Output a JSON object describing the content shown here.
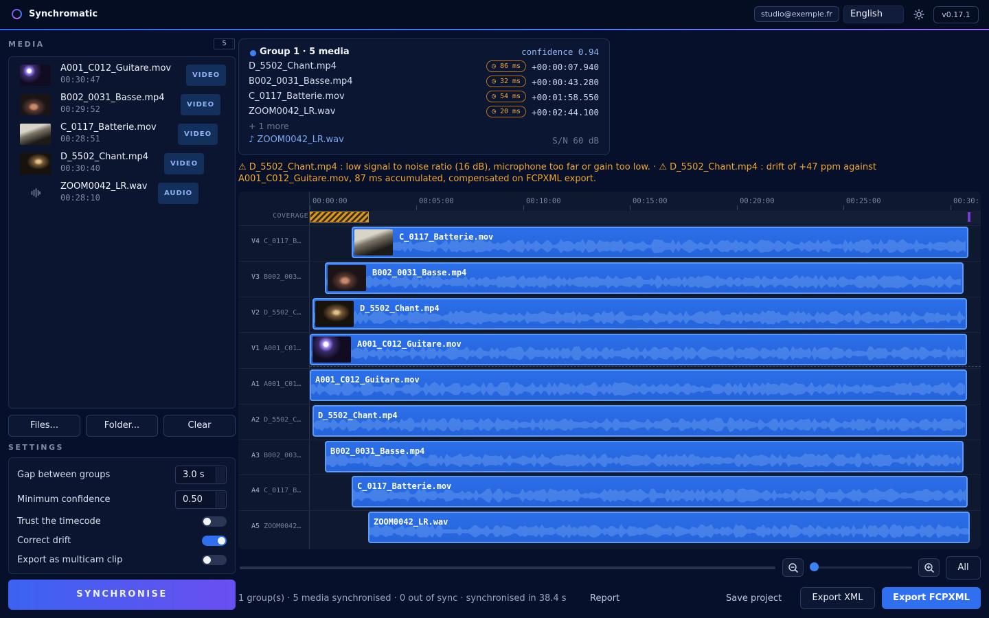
{
  "app": {
    "title": "Synchromatic",
    "account": "studio@exemple.fr",
    "language": "English",
    "version": "v0.17.1"
  },
  "media": {
    "section_title": "MEDIA",
    "count": "5",
    "items": [
      {
        "name": "A001_C012_Guitare.mov",
        "duration": "00:30:47",
        "type": "VIDEO"
      },
      {
        "name": "B002_0031_Basse.mp4",
        "duration": "00:29:52",
        "type": "VIDEO"
      },
      {
        "name": "C_0117_Batterie.mov",
        "duration": "00:28:51",
        "type": "VIDEO"
      },
      {
        "name": "D_5502_Chant.mp4",
        "duration": "00:30:40",
        "type": "VIDEO"
      },
      {
        "name": "ZOOM0042_LR.wav",
        "duration": "00:28:10",
        "type": "AUDIO"
      }
    ],
    "buttons": {
      "files": "Files...",
      "folder": "Folder...",
      "clear": "Clear"
    }
  },
  "settings": {
    "section_title": "SETTINGS",
    "gap_label": "Gap between groups",
    "gap_value": "3.0 s",
    "confidence_label": "Minimum confidence",
    "confidence_value": "0.50",
    "trust_timecode_label": "Trust the timecode",
    "trust_timecode": false,
    "correct_drift_label": "Correct drift",
    "correct_drift": true,
    "multicam_label": "Export as multicam clip",
    "multicam": false
  },
  "synchronise_label": "SYNCHRONISE",
  "group": {
    "title": "Group 1 · 5 media",
    "confidence": "confidence 0.94",
    "rows": [
      {
        "name": "D_5502_Chant.mp4",
        "badge": "◷ 86 ms",
        "offset": "+00:00:07.940"
      },
      {
        "name": "B002_0031_Basse.mp4",
        "badge": "◷ 32 ms",
        "offset": "+00:00:43.280"
      },
      {
        "name": "C_0117_Batterie.mov",
        "badge": "◷ 54 ms",
        "offset": "+00:01:58.550"
      },
      {
        "name": "ZOOM0042_LR.wav",
        "badge": "◷ 20 ms",
        "offset": "+00:02:44.100"
      }
    ],
    "more": "+ 1 more",
    "audio_ref": "♪ ZOOM0042_LR.wav",
    "snr": "S/N 60 dB"
  },
  "warning": "⚠ D_5502_Chant.mp4 : low signal to noise ratio (16 dB), microphone too far or gain too low.  ·  ⚠ D_5502_Chant.mp4 : drift of +47 ppm against A001_C012_Guitare.mov, 87 ms accumulated, compensated on FCPXML export.",
  "timeline": {
    "ruler": [
      "00:00:00",
      "00:05:00",
      "00:10:00",
      "00:15:00",
      "00:20:00",
      "00:25:00",
      "00:30:"
    ],
    "coverage_label": "COVERAGE",
    "tracks": [
      {
        "id": "V4",
        "short": "C_0117_B…",
        "clip": "C_0117_Batterie.mov"
      },
      {
        "id": "V3",
        "short": "B002_003…",
        "clip": "B002_0031_Basse.mp4"
      },
      {
        "id": "V2",
        "short": "D_5502_C…",
        "clip": "D_5502_Chant.mp4"
      },
      {
        "id": "V1",
        "short": "A001_C01…",
        "clip": "A001_C012_Guitare.mov"
      },
      {
        "id": "A1",
        "short": "A001_C01…",
        "clip": "A001_C012_Guitare.mov"
      },
      {
        "id": "A2",
        "short": "D_5502_C…",
        "clip": "D_5502_Chant.mp4"
      },
      {
        "id": "A3",
        "short": "B002_003…",
        "clip": "B002_0031_Basse.mp4"
      },
      {
        "id": "A4",
        "short": "C_0117_B…",
        "clip": "C_0117_Batterie.mov"
      },
      {
        "id": "A5",
        "short": "ZOOM0042…",
        "clip": "ZOOM0042_LR.wav"
      }
    ]
  },
  "zoom": {
    "all_label": "All"
  },
  "footer": {
    "status": "1 group(s) · 5 media synchronised · 0 out of sync  ·  synchronised in 38.4 s",
    "report": "Report",
    "save_project": "Save project",
    "export_xml": "Export XML",
    "export_fcpxml": "Export FCPXML"
  },
  "colors": {
    "accent": "#2f6ff0",
    "warning": "#f0a62e",
    "clip": "#2c6fe8",
    "background": "#06102a"
  },
  "icons": {
    "theme": "sun-icon",
    "zoom_out": "zoom-out-icon",
    "zoom_in": "zoom-in-icon",
    "audio": "waveform-icon"
  }
}
